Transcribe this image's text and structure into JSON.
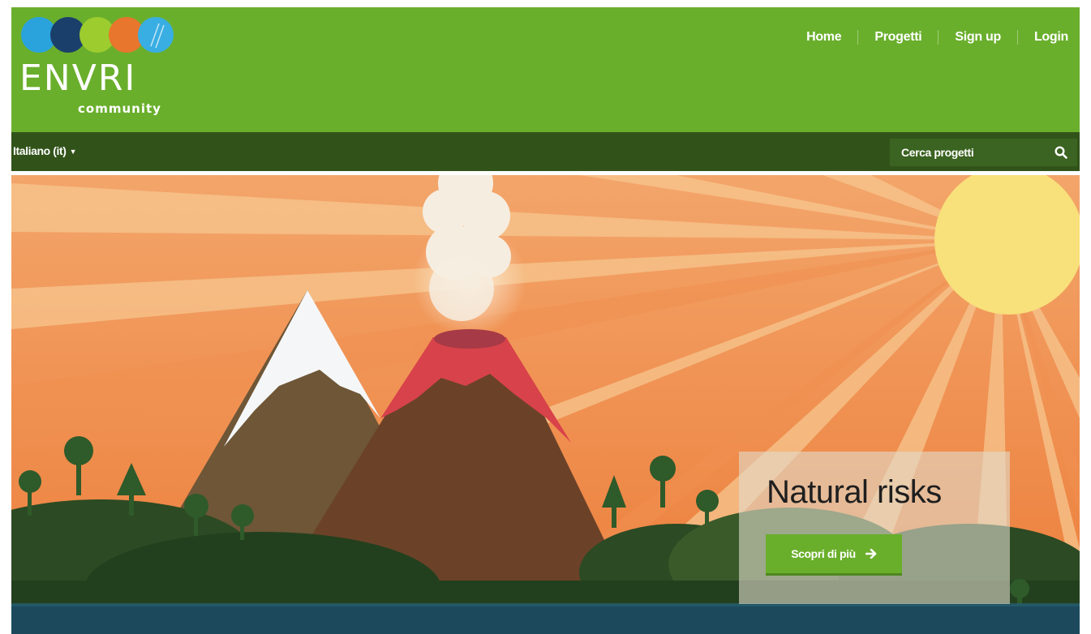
{
  "logo": {
    "word": "ENVRI",
    "sub": "community",
    "dot_colors": [
      "#2aa3dd",
      "#1b3f6b",
      "#9ccc2e",
      "#e8762d",
      "#39aee3"
    ]
  },
  "nav": {
    "items": [
      {
        "label": "Home"
      },
      {
        "label": "Progetti"
      },
      {
        "label": "Sign up"
      },
      {
        "label": "Login"
      }
    ]
  },
  "subbar": {
    "language": "Italiano (it)",
    "search_placeholder": "Cerca progetti"
  },
  "hero": {
    "title": "Natural risks",
    "button_label": "Scopri di più",
    "icons": {
      "arrow": "arrow-right-icon",
      "search": "search-icon"
    }
  },
  "colors": {
    "header_green": "#6aaf2c",
    "subbar_green": "#315319",
    "sky_orange": "#ef8a45",
    "sun_yellow": "#f8e07a",
    "accent_button": "#6aaf2c"
  }
}
